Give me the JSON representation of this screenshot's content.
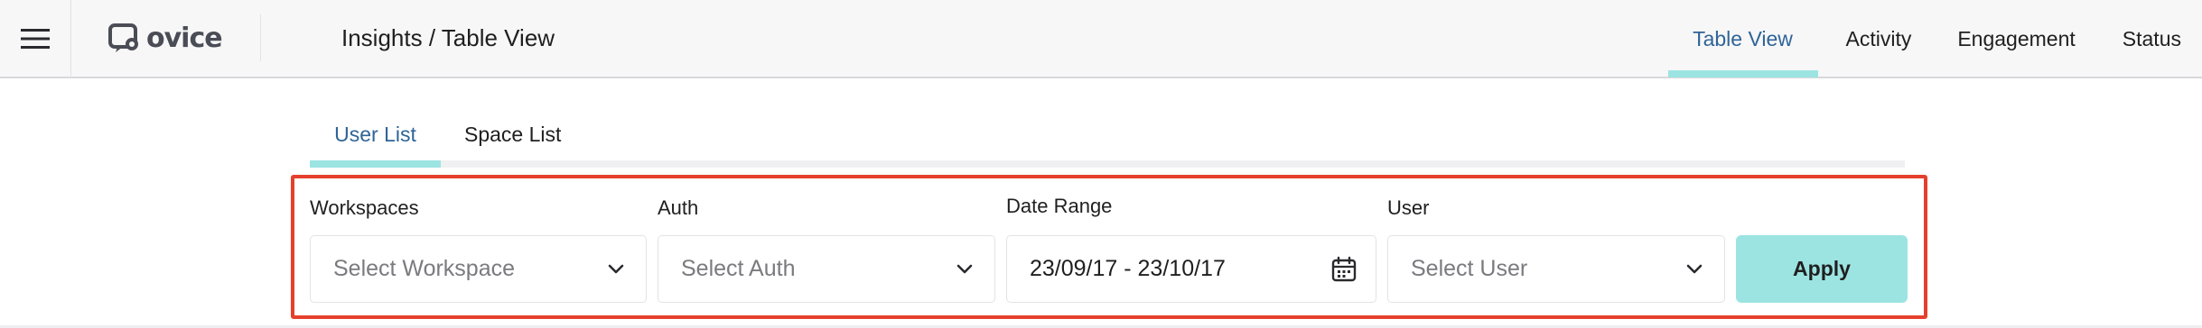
{
  "header": {
    "logo_text": "ovice",
    "breadcrumb": "Insights / Table View",
    "nav_tabs": [
      {
        "label": "Table View",
        "active": true
      },
      {
        "label": "Activity",
        "active": false
      },
      {
        "label": "Engagement",
        "active": false
      },
      {
        "label": "Status",
        "active": false
      }
    ]
  },
  "subtabs": [
    {
      "label": "User List",
      "active": true
    },
    {
      "label": "Space List",
      "active": false
    }
  ],
  "filters": {
    "workspaces": {
      "label": "Workspaces",
      "placeholder": "Select Workspace"
    },
    "auth": {
      "label": "Auth",
      "placeholder": "Select Auth"
    },
    "date_range": {
      "label": "Date Range",
      "value": "23/09/17 - 23/10/17"
    },
    "user": {
      "label": "User",
      "placeholder": "Select User"
    },
    "apply_label": "Apply"
  },
  "colors": {
    "accent": "#9ce4e2",
    "active_text": "#2f6497",
    "highlight_border": "#e5402d"
  },
  "icons": {
    "menu": "hamburger-menu-icon",
    "logo": "ovice-logo-icon",
    "dropdown": "chevron-down-icon",
    "calendar": "calendar-icon"
  }
}
